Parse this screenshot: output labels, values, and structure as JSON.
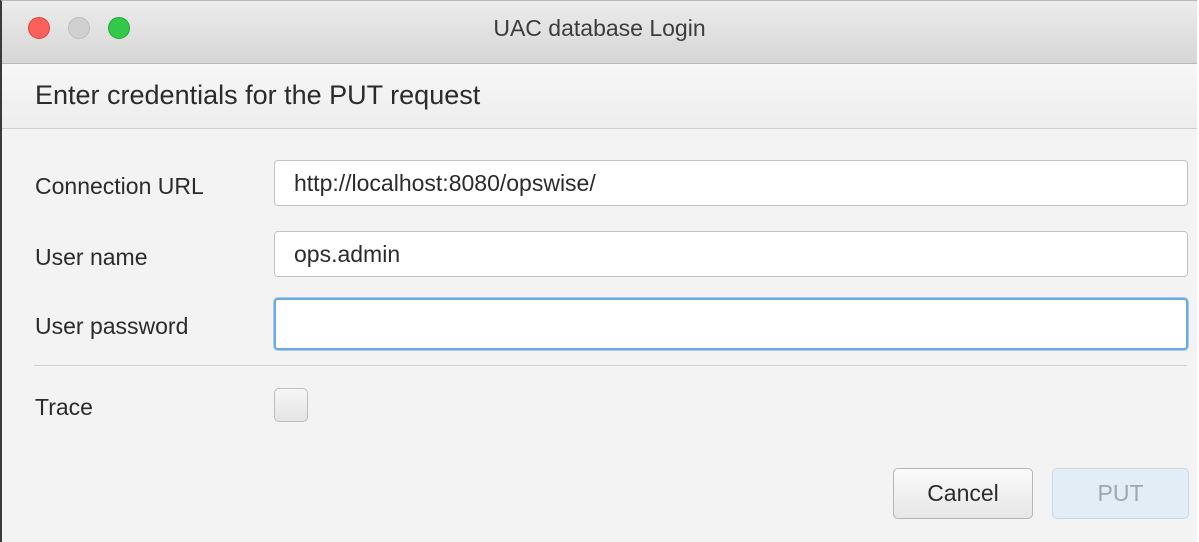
{
  "window": {
    "title": "UAC database Login",
    "traffic_lights": {
      "close": "#fc605c",
      "minimize": "#d0d0d0",
      "zoom": "#34c84a"
    }
  },
  "header": {
    "text": "Enter credentials for the PUT request"
  },
  "form": {
    "connection_url": {
      "label": "Connection URL",
      "value": "http://localhost:8080/opswise/"
    },
    "user_name": {
      "label": "User name",
      "value": "ops.admin"
    },
    "user_password": {
      "label": "User password",
      "value": ""
    },
    "trace": {
      "label": "Trace",
      "checked": false
    }
  },
  "buttons": {
    "cancel": "Cancel",
    "put": "PUT",
    "put_disabled": true
  },
  "colors": {
    "focus_ring": "#6fa8dc",
    "disabled_button_bg": "#e3edf5"
  }
}
